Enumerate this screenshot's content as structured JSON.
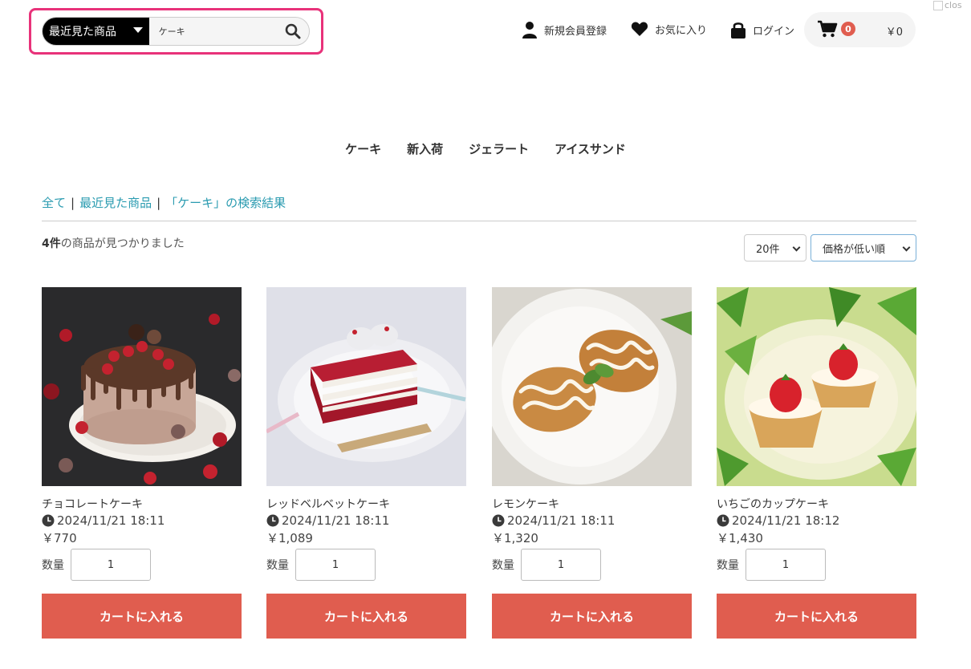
{
  "search": {
    "category": "最近見た商品",
    "value": "ケーキ"
  },
  "header": {
    "register": "新規会員登録",
    "favorites": "お気に入り",
    "login": "ログイン",
    "cart_count": "0",
    "cart_total": "￥0",
    "broken_image_alt": "clos"
  },
  "categories": [
    "ケーキ",
    "新入荷",
    "ジェラート",
    "アイスサンド"
  ],
  "breadcrumb": {
    "all": "全て",
    "recent": "最近見た商品",
    "result": "「ケーキ」の検索結果"
  },
  "results": {
    "count": "4件",
    "text": "の商品が見つかりました"
  },
  "per_page": "20件",
  "sort": "価格が低い順",
  "products": [
    {
      "name": "チョコレートケーキ",
      "date": "2024/11/21 18:11",
      "price": "￥770",
      "qty_label": "数量",
      "qty": "1",
      "button": "カートに入れる"
    },
    {
      "name": "レッドベルベットケーキ",
      "date": "2024/11/21 18:11",
      "price": "￥1,089",
      "qty_label": "数量",
      "qty": "1",
      "button": "カートに入れる"
    },
    {
      "name": "レモンケーキ",
      "date": "2024/11/21 18:11",
      "price": "￥1,320",
      "qty_label": "数量",
      "qty": "1",
      "button": "カートに入れる"
    },
    {
      "name": "いちごのカップケーキ",
      "date": "2024/11/21 18:12",
      "price": "￥1,430",
      "qty_label": "数量",
      "qty": "1",
      "button": "カートに入れる"
    }
  ],
  "colors": {
    "accent": "#e05d4f",
    "link": "#2a9bb0",
    "highlight": "#e8327a"
  }
}
